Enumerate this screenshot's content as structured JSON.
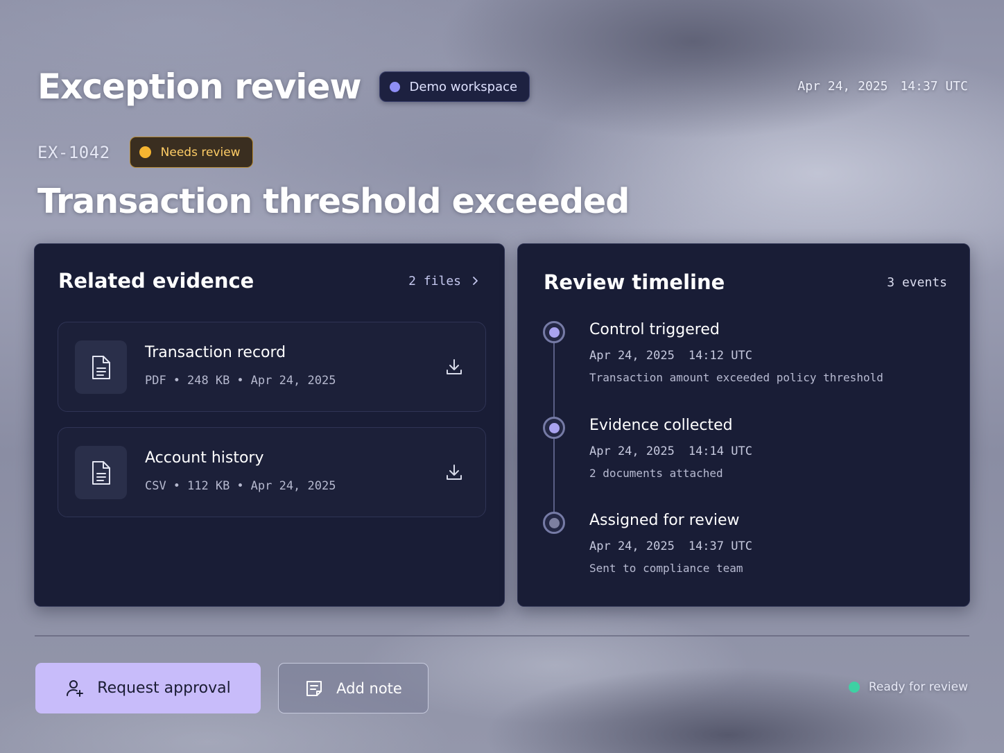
{
  "header": {
    "title": "Exception review",
    "workspace": "Demo workspace",
    "date": "Apr 24, 2025",
    "time": "14:37 UTC"
  },
  "exception": {
    "id": "EX-1042",
    "status": "Needs review",
    "title": "Transaction threshold exceeded"
  },
  "evidence": {
    "title": "Related evidence",
    "count_label": "2 files",
    "files": [
      {
        "name": "Transaction record",
        "type": "PDF",
        "size": "248 KB",
        "date": "Apr 24, 2025",
        "icon": "file-icon"
      },
      {
        "name": "Account history",
        "type": "CSV",
        "size": "112 KB",
        "date": "Apr 24, 2025",
        "icon": "file-icon"
      }
    ],
    "separator": "•"
  },
  "timeline": {
    "title": "Review timeline",
    "count_label": "3 events",
    "events": [
      {
        "title": "Control triggered",
        "date": "Apr 24, 2025",
        "time": "14:12 UTC",
        "description": "Transaction amount exceeded policy threshold"
      },
      {
        "title": "Evidence collected",
        "date": "Apr 24, 2025",
        "time": "14:14 UTC",
        "description": "2 documents attached"
      },
      {
        "title": "Assigned for review",
        "date": "Apr 24, 2025",
        "time": "14:37 UTC",
        "description": "Sent to compliance team"
      }
    ]
  },
  "footer": {
    "primary_label": "Request approval",
    "secondary_label": "Add note",
    "status_text": "Ready for review"
  },
  "colors": {
    "panel": "#191d36",
    "accent": "#c8bcfa",
    "warning": "#f6b531",
    "success": "#3ed1a3"
  }
}
